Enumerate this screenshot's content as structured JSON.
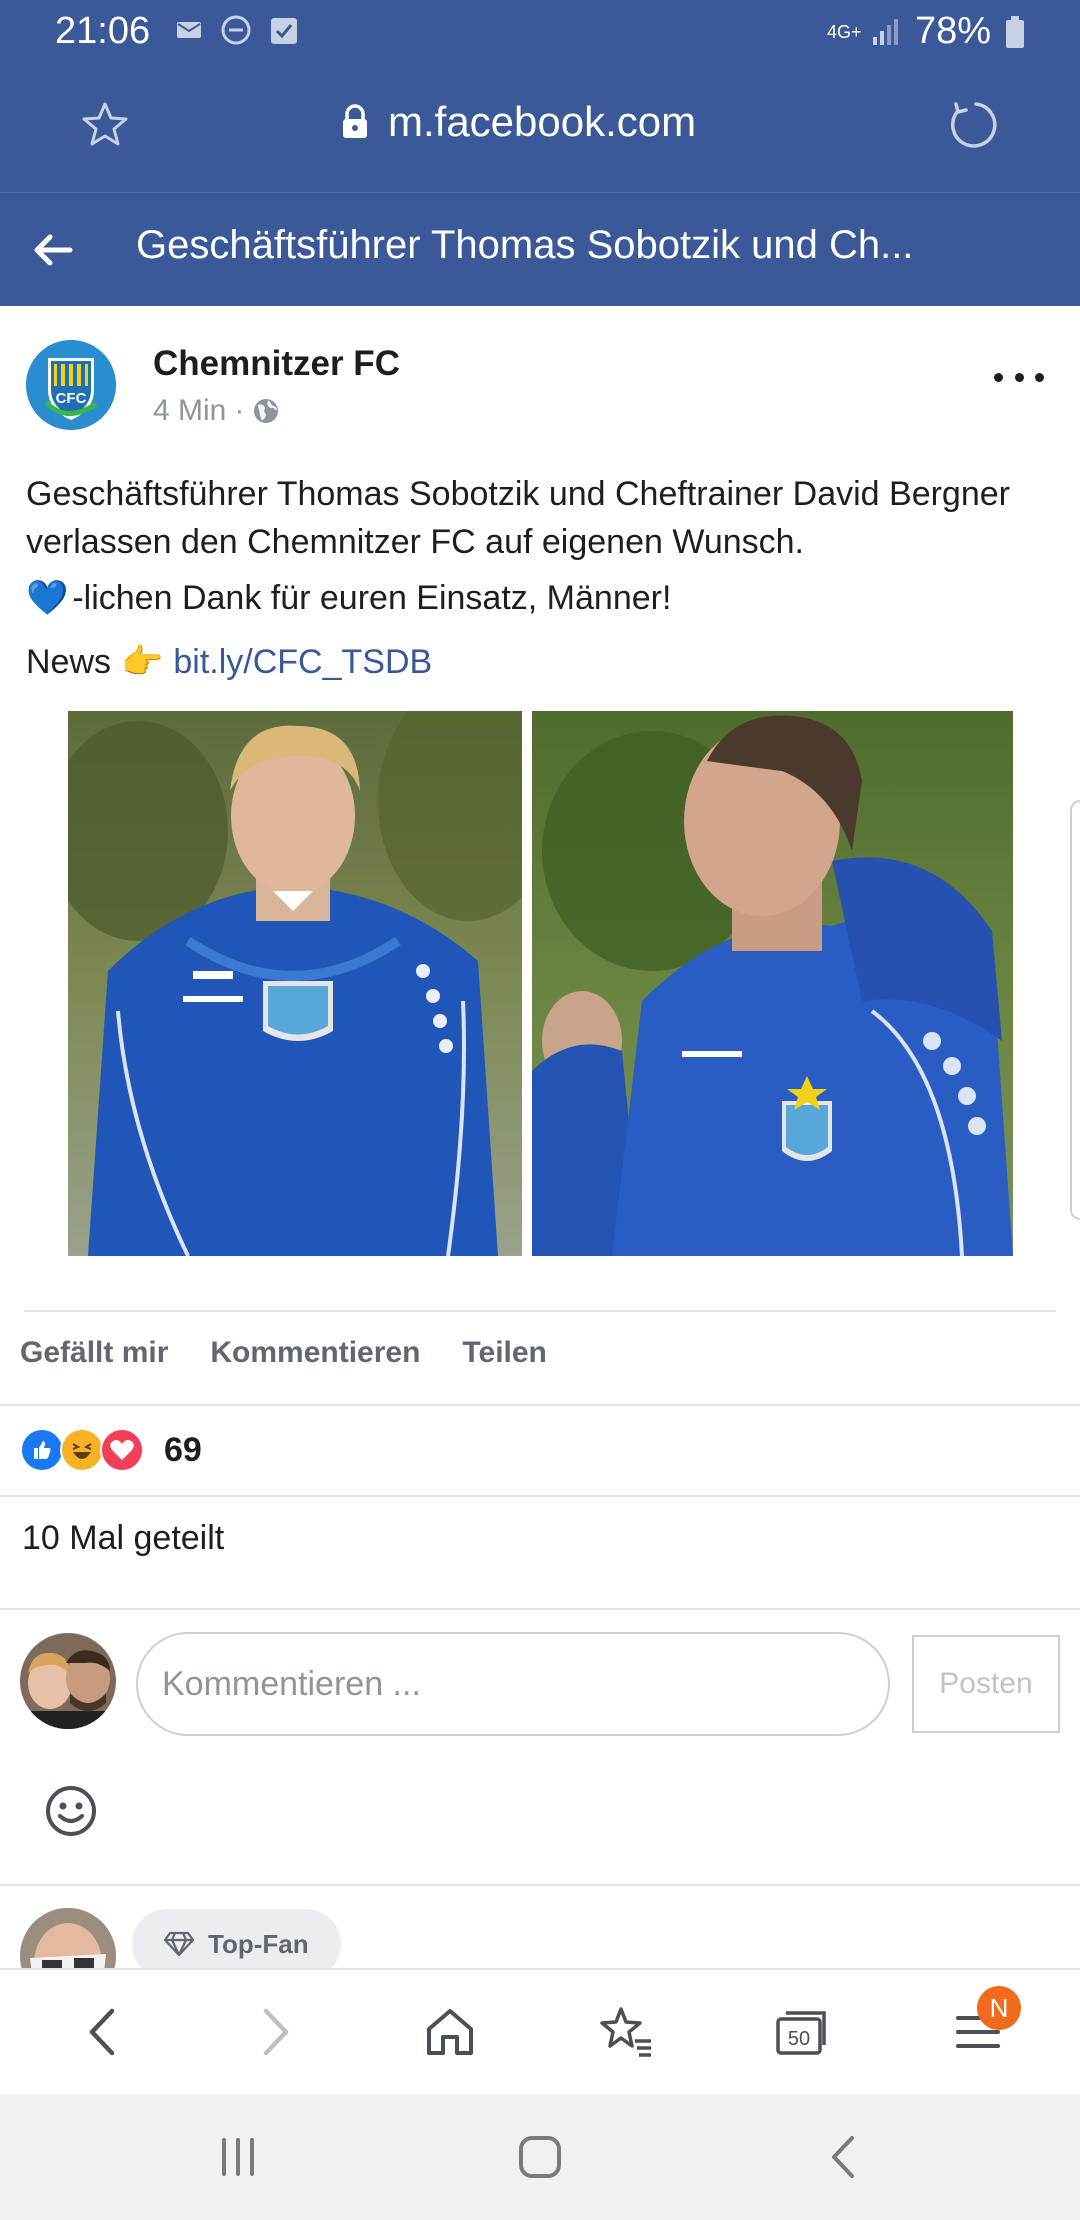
{
  "status_bar": {
    "time": "21:06",
    "network": "4G+",
    "battery": "78%"
  },
  "browser": {
    "url": "m.facebook.com"
  },
  "header": {
    "title": "Geschäftsführer Thomas Sobotzik und Ch..."
  },
  "post": {
    "page_name": "Chemnitzer FC",
    "time_ago": "4 Min",
    "separator": "·",
    "text_line1": "Geschäftsführer Thomas Sobotzik und Cheftrainer David Bergner verlassen den Chemnitzer FC auf eigenen Wunsch.",
    "text_line2": "-lichen Dank für euren Einsatz, Männer!",
    "heart_emoji": "💙",
    "news_label": "News",
    "pointing_emoji": "👉",
    "link": "bit.ly/CFC_TSDB",
    "logo_text": "CFC"
  },
  "actions": {
    "like": "Gefällt mir",
    "comment": "Kommentieren",
    "share": "Teilen"
  },
  "reactions": {
    "count": "69",
    "types": [
      "like-icon",
      "haha-icon",
      "love-icon"
    ]
  },
  "shares": {
    "text": "10 Mal geteilt"
  },
  "comment_box": {
    "placeholder": "Kommentieren ...",
    "post_button": "Posten"
  },
  "next_comment": {
    "badge": "Top-Fan"
  },
  "bottom_nav": {
    "tabs_count": "50",
    "menu_badge": "N"
  },
  "colors": {
    "facebook_blue": "#3b5998",
    "link": "#385898",
    "badge": "#f26b1d"
  }
}
